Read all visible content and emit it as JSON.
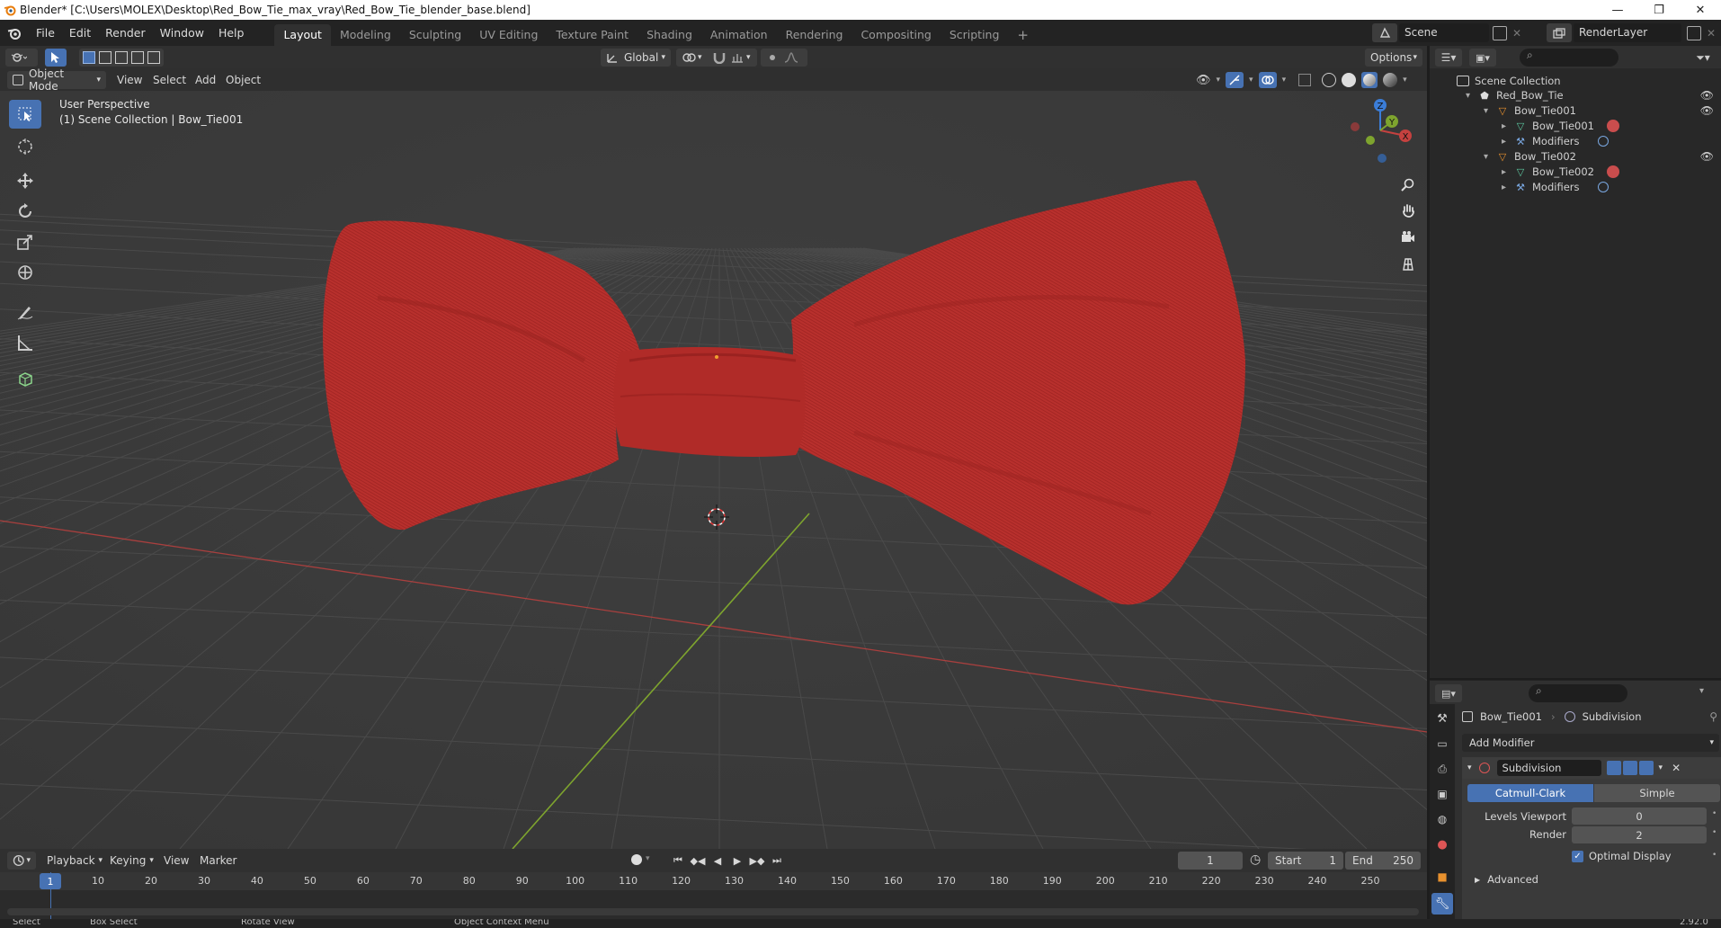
{
  "window": {
    "title": "Blender* [C:\\Users\\MOLEX\\Desktop\\Red_Bow_Tie_max_vray\\Red_Bow_Tie_blender_base.blend]",
    "minimize": "—",
    "maximize": "❐",
    "close": "✕"
  },
  "menu": [
    "File",
    "Edit",
    "Render",
    "Window",
    "Help"
  ],
  "workspaces": [
    "Layout",
    "Modeling",
    "Sculpting",
    "UV Editing",
    "Texture Paint",
    "Shading",
    "Animation",
    "Rendering",
    "Compositing",
    "Scripting"
  ],
  "add_workspace": "+",
  "scene": {
    "name": "Scene",
    "render_layer": "RenderLayer"
  },
  "viewport_header": {
    "orientation": "Global",
    "options": "Options",
    "mode": "Object Mode",
    "menus": [
      "View",
      "Select",
      "Add",
      "Object"
    ]
  },
  "viewport": {
    "perspective": "User Perspective",
    "collection_info": "(1) Scene Collection | Bow_Tie001",
    "object_color": "#b8302d",
    "gizmo": {
      "x": "X",
      "y": "Y",
      "z": "Z"
    }
  },
  "outliner": {
    "root": "Scene Collection",
    "rows": [
      {
        "label": "Red_Bow_Tie",
        "icon": "collection-icon"
      },
      {
        "label": "Bow_Tie001",
        "icon": "object-icon"
      },
      {
        "label": "Bow_Tie001",
        "icon": "mesh-icon"
      },
      {
        "label": "Modifiers",
        "icon": "wrench-icon"
      },
      {
        "label": "Bow_Tie002",
        "icon": "object-icon"
      },
      {
        "label": "Bow_Tie002",
        "icon": "mesh-icon"
      },
      {
        "label": "Modifiers",
        "icon": "wrench-icon"
      }
    ]
  },
  "properties": {
    "object": "Bow_Tie001",
    "modifier_context": "Subdivision",
    "add_modifier": "Add Modifier",
    "modifier_name": "Subdivision",
    "type_catmull": "Catmull-Clark",
    "type_simple": "Simple",
    "levels_viewport_label": "Levels Viewport",
    "levels_viewport": "0",
    "render_label": "Render",
    "render_value": "2",
    "optimal_display": "Optimal Display",
    "advanced": "Advanced"
  },
  "timeline": {
    "menus": [
      "Playback",
      "Keying",
      "View",
      "Marker"
    ],
    "current_frame": "1",
    "start_label": "Start",
    "start": "1",
    "end_label": "End",
    "end": "250",
    "ticks": [
      "1",
      "10",
      "20",
      "30",
      "40",
      "50",
      "60",
      "70",
      "80",
      "90",
      "100",
      "110",
      "120",
      "130",
      "140",
      "150",
      "160",
      "170",
      "180",
      "190",
      "200",
      "210",
      "220",
      "230",
      "240",
      "250"
    ]
  },
  "status": {
    "select": "Select",
    "box_select": "Box Select",
    "rotate": "Rotate View",
    "context": "Object Context Menu",
    "version": "2.92.0"
  },
  "colors": {
    "accent": "#4772b3",
    "x_axis": "#c5413f",
    "y_axis": "#7ea42e",
    "z_axis": "#3b7dd8",
    "bow_tie": "#b8302d"
  }
}
